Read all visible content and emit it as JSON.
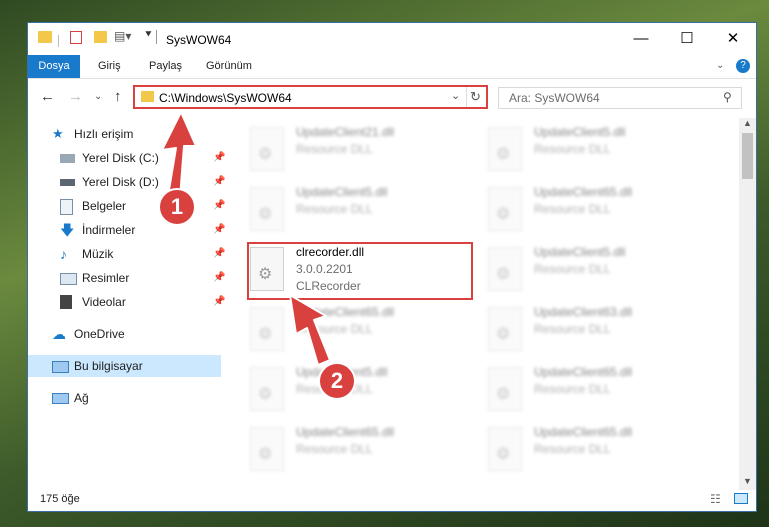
{
  "window": {
    "title": "SysWOW64"
  },
  "ribbon": {
    "tabs": [
      "Dosya",
      "Giriş",
      "Paylaş",
      "Görünüm"
    ]
  },
  "address": {
    "path": "C:\\Windows\\SysWOW64"
  },
  "search": {
    "placeholder": "Ara: SysWOW64"
  },
  "sidebar": {
    "items": [
      {
        "label": "Hızlı erişim"
      },
      {
        "label": "Yerel Disk (C:)"
      },
      {
        "label": "Yerel Disk (D:)"
      },
      {
        "label": "Belgeler"
      },
      {
        "label": "İndirmeler"
      },
      {
        "label": "Müzik"
      },
      {
        "label": "Resimler"
      },
      {
        "label": "Videolar"
      },
      {
        "label": "OneDrive"
      },
      {
        "label": "Bu bilgisayar"
      },
      {
        "label": "Ağ"
      }
    ]
  },
  "files": [
    {
      "name": "UpdateClient21.dll",
      "desc": "Resource DLL"
    },
    {
      "name": "UpdateClient5.dll",
      "desc": "Resource DLL"
    },
    {
      "name": "UpdateClient5.dll",
      "desc": "Resource DLL"
    },
    {
      "name": "UpdateClient65.dll",
      "desc": "Resource DLL"
    },
    {
      "name": "clrecorder.dll",
      "desc": "3.0.0.2201",
      "desc2": "CLRecorder"
    },
    {
      "name": "UpdateClient5.dll",
      "desc": "Resource DLL"
    },
    {
      "name": "UpdateClient65.dll",
      "desc": "Resource DLL"
    },
    {
      "name": "UpdateClient63.dll",
      "desc": "Resource DLL"
    },
    {
      "name": "UpdateClient5.dll",
      "desc": "Resource DLL"
    },
    {
      "name": "UpdateClient65.dll",
      "desc": "Resource DLL"
    },
    {
      "name": "UpdateClient65.dll",
      "desc": "Resource DLL"
    },
    {
      "name": "UpdateClient65.dll",
      "desc": "Resource DLL"
    }
  ],
  "status": {
    "count": "175 öğe"
  },
  "annotations": {
    "step1": "1",
    "step2": "2"
  },
  "colors": {
    "accent": "#1979ca",
    "highlight": "#d9413f",
    "selection": "#cce8ff"
  }
}
